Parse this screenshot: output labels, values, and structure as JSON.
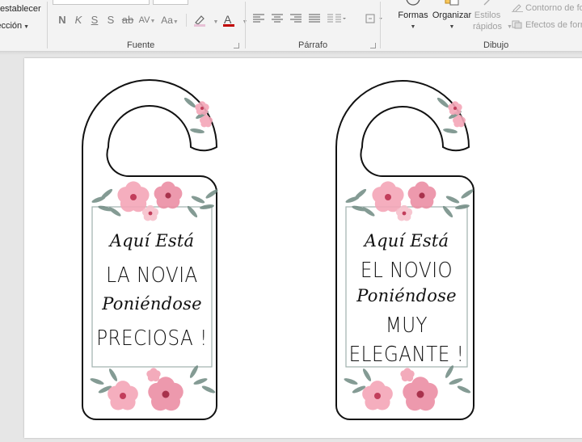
{
  "ribbon": {
    "left_commands": [
      "Restablecer",
      "Sección"
    ],
    "font": {
      "group_label": "Fuente",
      "format_labels": [
        "N",
        "K",
        "S",
        "S",
        "ab",
        "AV",
        "Aa"
      ],
      "font_color_glyph": "A"
    },
    "paragraph": {
      "group_label": "Párrafo"
    },
    "drawing": {
      "group_label": "Dibujo",
      "shapes_label": "Formas",
      "arrange_label": "Organizar",
      "quick_styles_line1": "Estilos",
      "quick_styles_line2": "rápidos",
      "shape_outline_label": "Contorno de fo",
      "shape_effects_label": "Efectos de form"
    },
    "colors": {
      "highlight": "#e8c1d6",
      "font_color": "#c00000"
    }
  },
  "door_hangers": [
    {
      "line1": "Aquí Está",
      "line2": "LA NOVIA",
      "line3": "Poniéndose",
      "line4": "PRECIOSA !"
    },
    {
      "line1": "Aquí Está",
      "line2": "EL NOVIO",
      "line3": "Poniéndose",
      "line4": "MUY",
      "line5": "ELEGANTE !"
    }
  ],
  "decor": {
    "flower_color": "#f2a2b4",
    "flower_center": "#c23e5b",
    "leaf_color": "#6f8a82",
    "frame_color": "#9fb1ad"
  }
}
